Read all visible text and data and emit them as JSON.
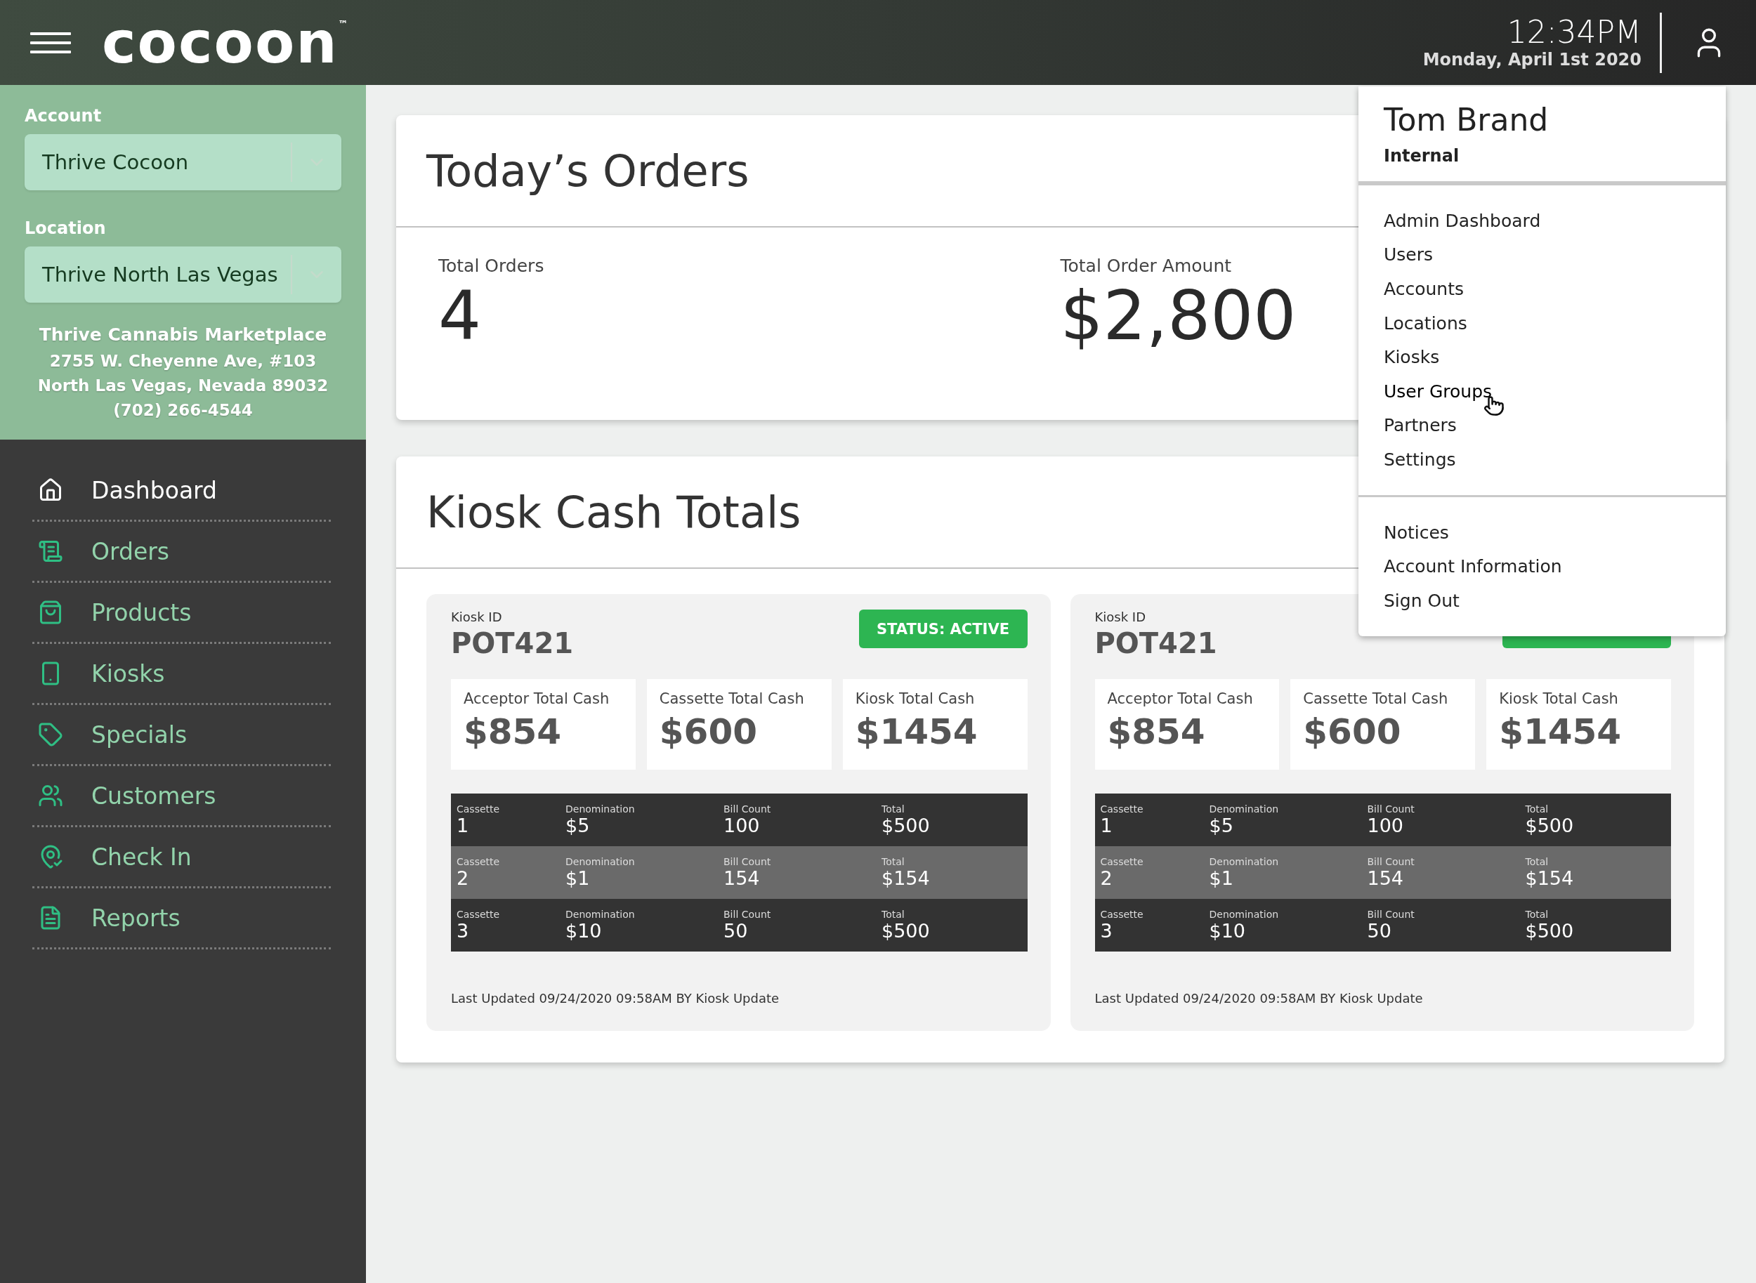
{
  "header": {
    "logo": "cocoon",
    "logo_mark": "™",
    "time": "12:34PM",
    "date": "Monday, April 1st 2020"
  },
  "sidebar": {
    "account": {
      "label": "Account",
      "value": "Thrive Cocoon"
    },
    "location": {
      "label": "Location",
      "value": "Thrive North Las Vegas"
    },
    "address": [
      "Thrive Cannabis Marketplace",
      "2755 W. Cheyenne Ave, #103",
      "North Las Vegas, Nevada 89032",
      "(702) 266-4544"
    ],
    "nav": [
      {
        "label": "Dashboard",
        "selected": true
      },
      {
        "label": "Orders",
        "selected": false
      },
      {
        "label": "Products",
        "selected": false
      },
      {
        "label": "Kiosks",
        "selected": false
      },
      {
        "label": "Specials",
        "selected": false
      },
      {
        "label": "Customers",
        "selected": false
      },
      {
        "label": "Check In",
        "selected": false
      },
      {
        "label": "Reports",
        "selected": false
      }
    ]
  },
  "todays_orders": {
    "title": "Today’s Orders",
    "stats": [
      {
        "label": "Total Orders",
        "value": "4"
      },
      {
        "label": "Total Order Amount",
        "value": "$2,800"
      }
    ]
  },
  "kiosk_cash": {
    "title": "Kiosk Cash Totals",
    "kiosks": [
      {
        "id_label": "Kiosk ID",
        "id": "POT421",
        "status": "STATUS: ACTIVE",
        "totals": [
          {
            "label": "Acceptor Total Cash",
            "value": "$854"
          },
          {
            "label": "Cassette Total Cash",
            "value": "$600"
          },
          {
            "label": "Kiosk Total Cash",
            "value": "$1454"
          }
        ],
        "rows": [
          {
            "selected": false,
            "cells": [
              {
                "label": "Cassette",
                "value": "1"
              },
              {
                "label": "Denomination",
                "value": "$5"
              },
              {
                "label": "Bill Count",
                "value": "100"
              },
              {
                "label": "Total",
                "value": "$500"
              }
            ]
          },
          {
            "selected": true,
            "cells": [
              {
                "label": "Cassette",
                "value": "2"
              },
              {
                "label": "Denomination",
                "value": "$1"
              },
              {
                "label": "Bill Count",
                "value": "154"
              },
              {
                "label": "Total",
                "value": "$154"
              }
            ]
          },
          {
            "selected": false,
            "cells": [
              {
                "label": "Cassette",
                "value": "3"
              },
              {
                "label": "Denomination",
                "value": "$10"
              },
              {
                "label": "Bill Count",
                "value": "50"
              },
              {
                "label": "Total",
                "value": "$500"
              }
            ]
          }
        ],
        "last_updated": "Last Updated 09/24/2020 09:58AM BY Kiosk Update"
      },
      {
        "id_label": "Kiosk ID",
        "id": "POT421",
        "totals": [
          {
            "label": "Acceptor Total Cash",
            "value": "$854"
          },
          {
            "label": "Cassette Total Cash",
            "value": "$600"
          },
          {
            "label": "Kiosk Total Cash",
            "value": "$1454"
          }
        ],
        "rows": [
          {
            "selected": false,
            "cells": [
              {
                "label": "Cassette",
                "value": "1"
              },
              {
                "label": "Denomination",
                "value": "$5"
              },
              {
                "label": "Bill Count",
                "value": "100"
              },
              {
                "label": "Total",
                "value": "$500"
              }
            ]
          },
          {
            "selected": true,
            "cells": [
              {
                "label": "Cassette",
                "value": "2"
              },
              {
                "label": "Denomination",
                "value": "$1"
              },
              {
                "label": "Bill Count",
                "value": "154"
              },
              {
                "label": "Total",
                "value": "$154"
              }
            ]
          },
          {
            "selected": false,
            "cells": [
              {
                "label": "Cassette",
                "value": "3"
              },
              {
                "label": "Denomination",
                "value": "$10"
              },
              {
                "label": "Bill Count",
                "value": "50"
              },
              {
                "label": "Total",
                "value": "$500"
              }
            ]
          }
        ],
        "last_updated": "Last Updated 09/24/2020 09:58AM BY Kiosk Update"
      }
    ]
  },
  "user_menu": {
    "name": "Tom Brand",
    "role": "Internal",
    "groups": [
      [
        {
          "label": "Admin Dashboard",
          "hovered": false
        },
        {
          "label": "Users",
          "hovered": false
        },
        {
          "label": "Accounts",
          "hovered": false
        },
        {
          "label": "Locations",
          "hovered": false
        },
        {
          "label": "Kiosks",
          "hovered": false
        },
        {
          "label": "User Groups",
          "hovered": true
        },
        {
          "label": "Partners",
          "hovered": false
        },
        {
          "label": "Settings",
          "hovered": false
        }
      ],
      [
        {
          "label": "Notices",
          "hovered": false
        },
        {
          "label": "Account Information",
          "hovered": false
        },
        {
          "label": "Sign Out",
          "hovered": false
        }
      ]
    ]
  }
}
